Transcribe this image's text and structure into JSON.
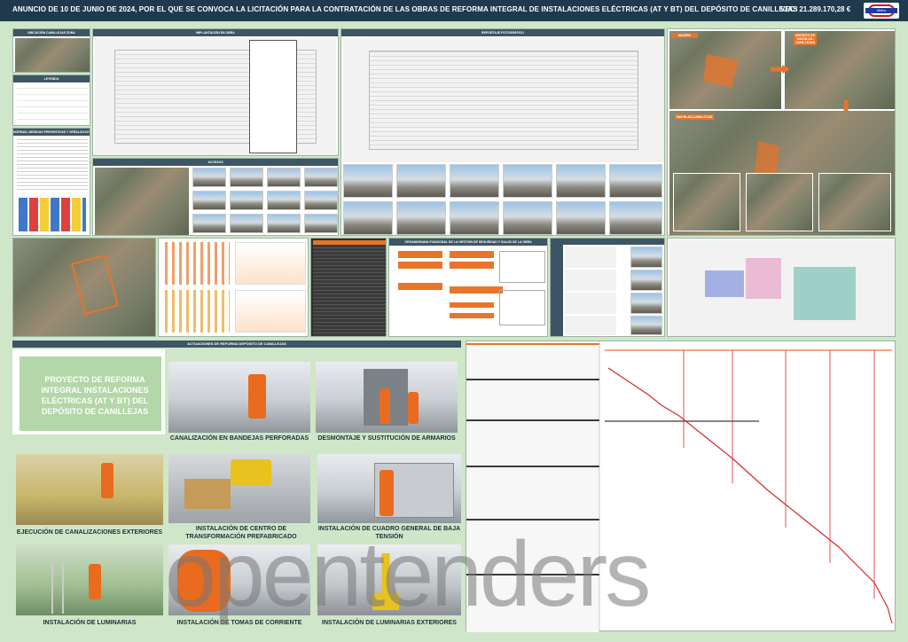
{
  "header": {
    "title": "ANUNCIO DE 10 DE JUNIO DE 2024, POR EL QUE SE CONVOCA LA LICITACIÓN PARA LA CONTRATACIÓN DE LAS OBRAS DE REFORMA INTEGRAL DE INSTALACIONES ELÉCTRICAS (AT Y BT) DEL DEPÓSITO DE CANILLEJAS",
    "vec": "VEC: 21.289.170,28 €",
    "logo_text": "Metro"
  },
  "top_panels": {
    "ubicacion": "UBICACIÓN CANILLEJAS ZONA",
    "leyenda": "LEYENDA",
    "normas": "NORMAS, MEDIDAS PREVENTIVAS Y SEÑALIZACIÓN",
    "implantacion": "IMPLANTACIÓN EN OBRA",
    "reportaje": "REPORTAJE FOTOGRÁFICO",
    "accesos": "ACCESOS",
    "organigrama": "ORGANIGRAMA FUNCIONAL DE LA GESTIÓN DE SEGURIDAD Y SALUD DE LA OBRA"
  },
  "map_labels": {
    "madrid": "MADRID",
    "distrito": "DISTRITO DE SAN BLAS-CANILLEJAS",
    "san_blas": "SAN BLAS-CANILLEJAS",
    "deposito": "DEPÓSITO CANILLEJAS"
  },
  "section": {
    "title": "ACTUACIONES DE REFORMA DEPÓSITO DE CANILLEJAS",
    "project_title": "PROYECTO DE REFORMA INTEGRAL INSTALACIONES ELÉCTRICAS (AT Y BT) DEL DEPÓSITO DE CANILLEJAS"
  },
  "scenes": [
    {
      "caption": "CANALIZACIÓN EN BANDEJAS PERFORADAS"
    },
    {
      "caption": "DESMONTAJE Y SUSTITUCIÓN DE ARMARIOS"
    },
    {
      "caption": "EJECUCIÓN DE CANALIZACIONES EXTERIORES"
    },
    {
      "caption": "INSTALACIÓN DE CENTRO DE TRANSFORMACIÓN PREFABRICADO"
    },
    {
      "caption": "INSTALACIÓN DE CUADRO GENERAL DE BAJA TENSIÓN"
    },
    {
      "caption": "INSTALACIÓN DE LUMINARIAS"
    },
    {
      "caption": "INSTALACIÓN DE TOMAS DE CORRIENTE"
    },
    {
      "caption": "INSTALACIÓN DE LUMINARIAS EXTERIORES"
    }
  ],
  "watermark": "opentenders",
  "colors": {
    "header": "#1f3a4d",
    "accent": "#e8742a",
    "background": "#cfe6c8",
    "gantt_line": "#d62a2a"
  }
}
